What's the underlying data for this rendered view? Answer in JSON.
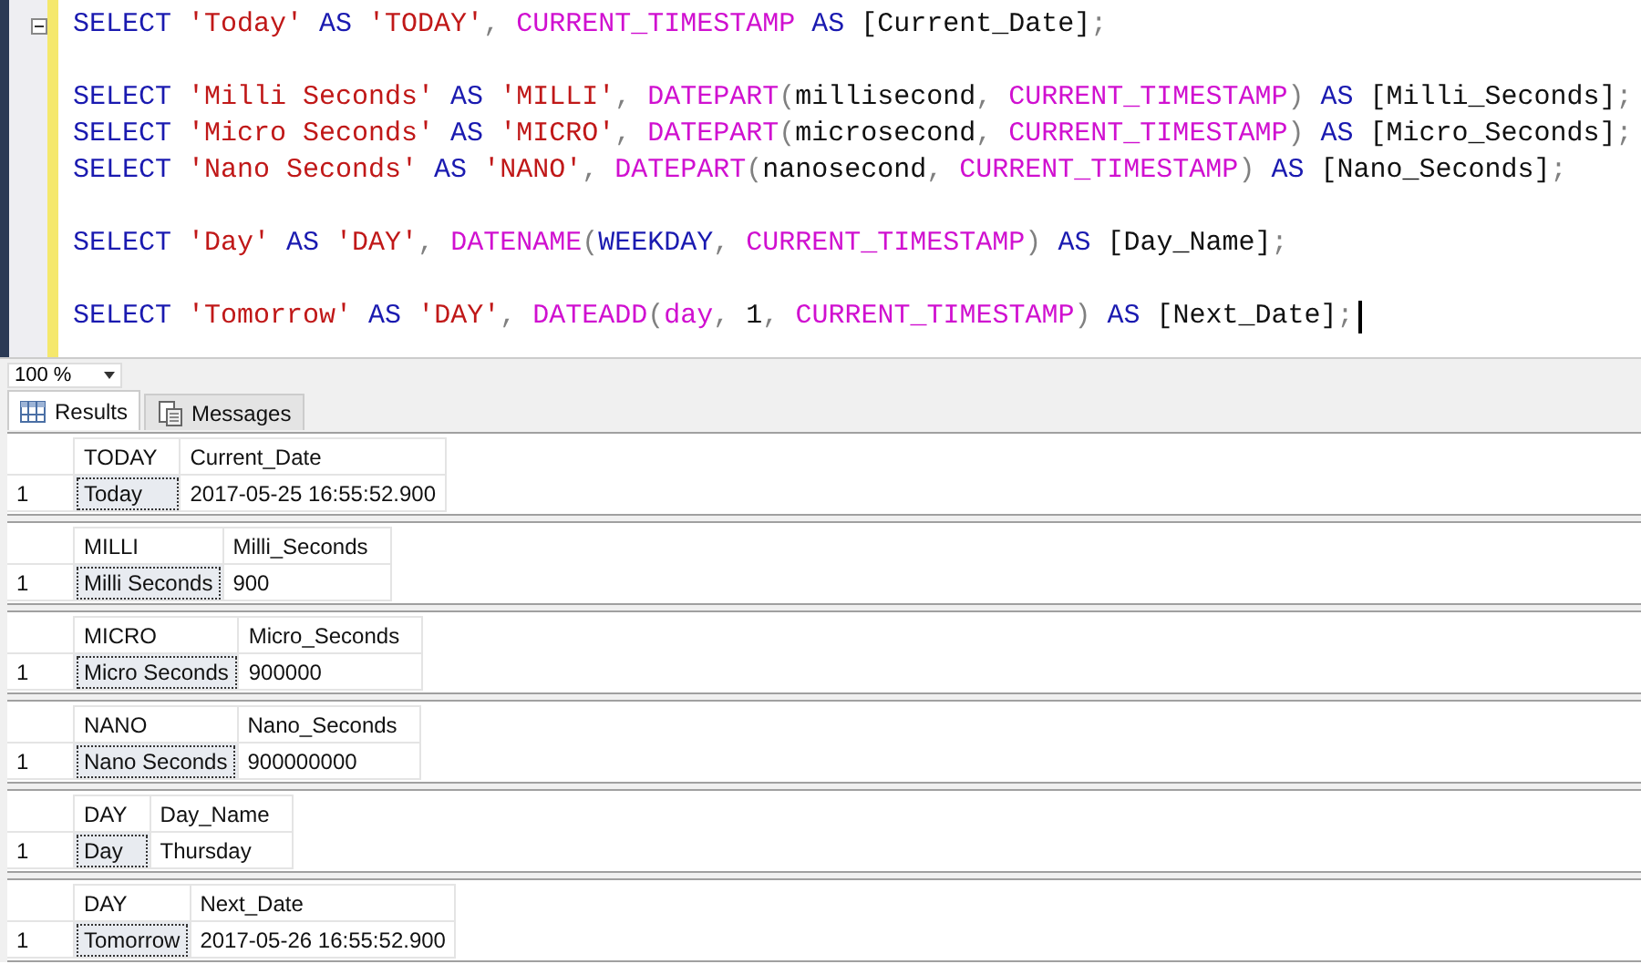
{
  "editor": {
    "lines": [
      {
        "collapsible": true,
        "cursor": false,
        "tokens": [
          {
            "kind": "keyword",
            "text": "SELECT "
          },
          {
            "kind": "string",
            "text": "'Today' "
          },
          {
            "kind": "keyword",
            "text": "AS "
          },
          {
            "kind": "string",
            "text": "'TODAY'"
          },
          {
            "kind": "punct",
            "text": ", "
          },
          {
            "kind": "function",
            "text": "CURRENT_TIMESTAMP "
          },
          {
            "kind": "keyword",
            "text": "AS "
          },
          {
            "kind": "plain",
            "text": "[Current_Date]"
          },
          {
            "kind": "punct",
            "text": ";"
          }
        ]
      },
      {
        "collapsible": false,
        "cursor": false
      },
      {
        "collapsible": false,
        "cursor": false,
        "tokens": [
          {
            "kind": "keyword",
            "text": "SELECT "
          },
          {
            "kind": "string",
            "text": "'Milli Seconds' "
          },
          {
            "kind": "keyword",
            "text": "AS "
          },
          {
            "kind": "string",
            "text": "'MILLI'"
          },
          {
            "kind": "punct",
            "text": ", "
          },
          {
            "kind": "function",
            "text": "DATEPART"
          },
          {
            "kind": "punct",
            "text": "("
          },
          {
            "kind": "plain",
            "text": "millisecond"
          },
          {
            "kind": "punct",
            "text": ", "
          },
          {
            "kind": "function",
            "text": "CURRENT_TIMESTAMP"
          },
          {
            "kind": "punct",
            "text": ") "
          },
          {
            "kind": "keyword",
            "text": "AS "
          },
          {
            "kind": "plain",
            "text": "[Milli_Seconds]"
          },
          {
            "kind": "punct",
            "text": ";"
          }
        ]
      },
      {
        "collapsible": false,
        "cursor": false,
        "tokens": [
          {
            "kind": "keyword",
            "text": "SELECT "
          },
          {
            "kind": "string",
            "text": "'Micro Seconds' "
          },
          {
            "kind": "keyword",
            "text": "AS "
          },
          {
            "kind": "string",
            "text": "'MICRO'"
          },
          {
            "kind": "punct",
            "text": ", "
          },
          {
            "kind": "function",
            "text": "DATEPART"
          },
          {
            "kind": "punct",
            "text": "("
          },
          {
            "kind": "plain",
            "text": "microsecond"
          },
          {
            "kind": "punct",
            "text": ", "
          },
          {
            "kind": "function",
            "text": "CURRENT_TIMESTAMP"
          },
          {
            "kind": "punct",
            "text": ") "
          },
          {
            "kind": "keyword",
            "text": "AS "
          },
          {
            "kind": "plain",
            "text": "[Micro_Seconds]"
          },
          {
            "kind": "punct",
            "text": ";"
          }
        ]
      },
      {
        "collapsible": false,
        "cursor": false,
        "tokens": [
          {
            "kind": "keyword",
            "text": "SELECT "
          },
          {
            "kind": "string",
            "text": "'Nano Seconds' "
          },
          {
            "kind": "keyword",
            "text": "AS "
          },
          {
            "kind": "string",
            "text": "'NANO'"
          },
          {
            "kind": "punct",
            "text": ", "
          },
          {
            "kind": "function",
            "text": "DATEPART"
          },
          {
            "kind": "punct",
            "text": "("
          },
          {
            "kind": "plain",
            "text": "nanosecond"
          },
          {
            "kind": "punct",
            "text": ", "
          },
          {
            "kind": "function",
            "text": "CURRENT_TIMESTAMP"
          },
          {
            "kind": "punct",
            "text": ") "
          },
          {
            "kind": "keyword",
            "text": "AS "
          },
          {
            "kind": "plain",
            "text": "[Nano_Seconds]"
          },
          {
            "kind": "punct",
            "text": ";"
          }
        ]
      },
      {
        "collapsible": false,
        "cursor": false
      },
      {
        "collapsible": false,
        "cursor": false,
        "tokens": [
          {
            "kind": "keyword",
            "text": "SELECT "
          },
          {
            "kind": "string",
            "text": "'Day' "
          },
          {
            "kind": "keyword",
            "text": "AS "
          },
          {
            "kind": "string",
            "text": "'DAY'"
          },
          {
            "kind": "punct",
            "text": ", "
          },
          {
            "kind": "function",
            "text": "DATENAME"
          },
          {
            "kind": "punct",
            "text": "("
          },
          {
            "kind": "keyword",
            "text": "WEEKDAY"
          },
          {
            "kind": "punct",
            "text": ", "
          },
          {
            "kind": "function",
            "text": "CURRENT_TIMESTAMP"
          },
          {
            "kind": "punct",
            "text": ") "
          },
          {
            "kind": "keyword",
            "text": "AS "
          },
          {
            "kind": "plain",
            "text": "[Day_Name]"
          },
          {
            "kind": "punct",
            "text": ";"
          }
        ]
      },
      {
        "collapsible": false,
        "cursor": false
      },
      {
        "collapsible": false,
        "cursor": true,
        "tokens": [
          {
            "kind": "keyword",
            "text": "SELECT "
          },
          {
            "kind": "string",
            "text": "'Tomorrow' "
          },
          {
            "kind": "keyword",
            "text": "AS "
          },
          {
            "kind": "string",
            "text": "'DAY'"
          },
          {
            "kind": "punct",
            "text": ", "
          },
          {
            "kind": "function",
            "text": "DATEADD"
          },
          {
            "kind": "punct",
            "text": "("
          },
          {
            "kind": "function",
            "text": "day"
          },
          {
            "kind": "punct",
            "text": ", "
          },
          {
            "kind": "plain",
            "text": "1"
          },
          {
            "kind": "punct",
            "text": ", "
          },
          {
            "kind": "function",
            "text": "CURRENT_TIMESTAMP"
          },
          {
            "kind": "punct",
            "text": ") "
          },
          {
            "kind": "keyword",
            "text": "AS "
          },
          {
            "kind": "plain",
            "text": "[Next_Date]"
          },
          {
            "kind": "punct",
            "text": ";"
          }
        ]
      }
    ]
  },
  "zoom": {
    "value": "100 %"
  },
  "tabs": [
    {
      "label": "Results",
      "selected": true
    },
    {
      "label": "Messages",
      "selected": false
    }
  ],
  "results": [
    {
      "columns": [
        "TODAY",
        "Current_Date"
      ],
      "rows": [
        {
          "number": "1",
          "cells": [
            {
              "text": "Today",
              "selected": true
            },
            {
              "text": "2017-05-25 16:55:52.900",
              "selected": false
            }
          ]
        }
      ]
    },
    {
      "columns": [
        "MILLI",
        "Milli_Seconds"
      ],
      "rows": [
        {
          "number": "1",
          "cells": [
            {
              "text": "Milli Seconds",
              "selected": true
            },
            {
              "text": "900",
              "selected": false
            }
          ]
        }
      ]
    },
    {
      "columns": [
        "MICRO",
        "Micro_Seconds"
      ],
      "rows": [
        {
          "number": "1",
          "cells": [
            {
              "text": "Micro Seconds",
              "selected": true
            },
            {
              "text": "900000",
              "selected": false
            }
          ]
        }
      ]
    },
    {
      "columns": [
        "NANO",
        "Nano_Seconds"
      ],
      "rows": [
        {
          "number": "1",
          "cells": [
            {
              "text": "Nano Seconds",
              "selected": true
            },
            {
              "text": "900000000",
              "selected": false
            }
          ]
        }
      ]
    },
    {
      "columns": [
        "DAY",
        "Day_Name"
      ],
      "rows": [
        {
          "number": "1",
          "cells": [
            {
              "text": "Day",
              "selected": true
            },
            {
              "text": "Thursday",
              "selected": false
            }
          ]
        }
      ]
    },
    {
      "columns": [
        "DAY",
        "Next_Date"
      ],
      "rows": [
        {
          "number": "1",
          "cells": [
            {
              "text": "Tomorrow",
              "selected": true
            },
            {
              "text": "2017-05-26 16:55:52.900",
              "selected": false
            }
          ]
        }
      ]
    }
  ]
}
